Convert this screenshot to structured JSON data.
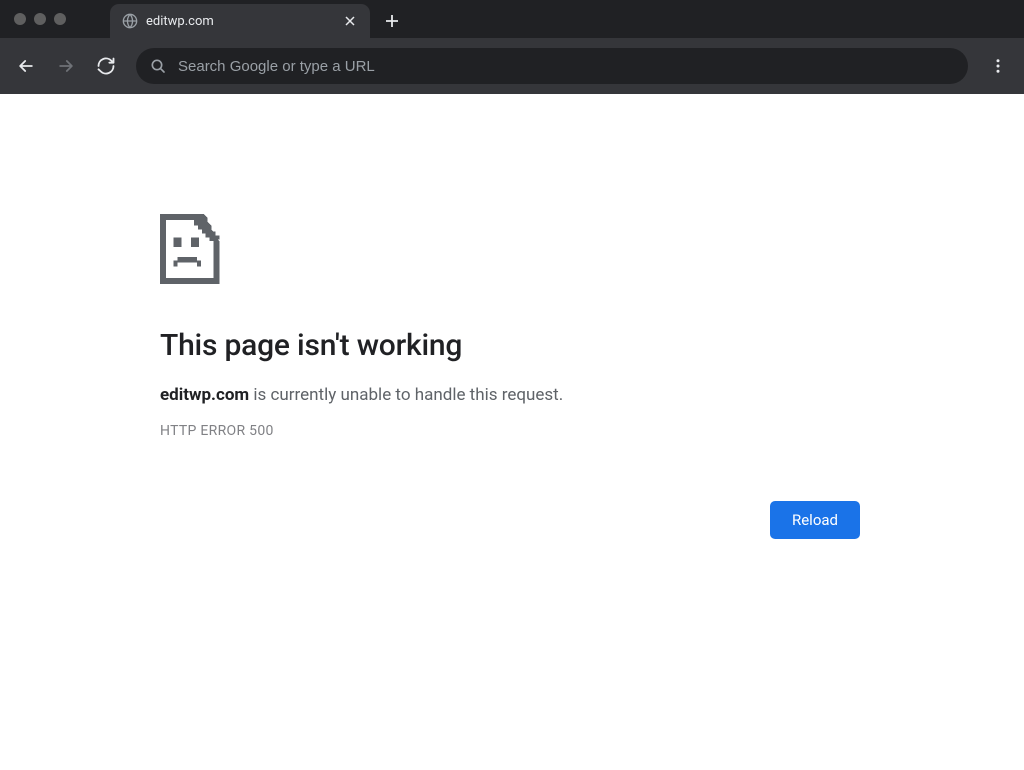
{
  "tab": {
    "title": "editwp.com"
  },
  "omnibox": {
    "placeholder": "Search Google or type a URL"
  },
  "error": {
    "title": "This page isn't working",
    "host_strong": "editwp.com",
    "message_rest": " is currently unable to handle this request.",
    "code": "HTTP ERROR 500",
    "reload_label": "Reload"
  }
}
